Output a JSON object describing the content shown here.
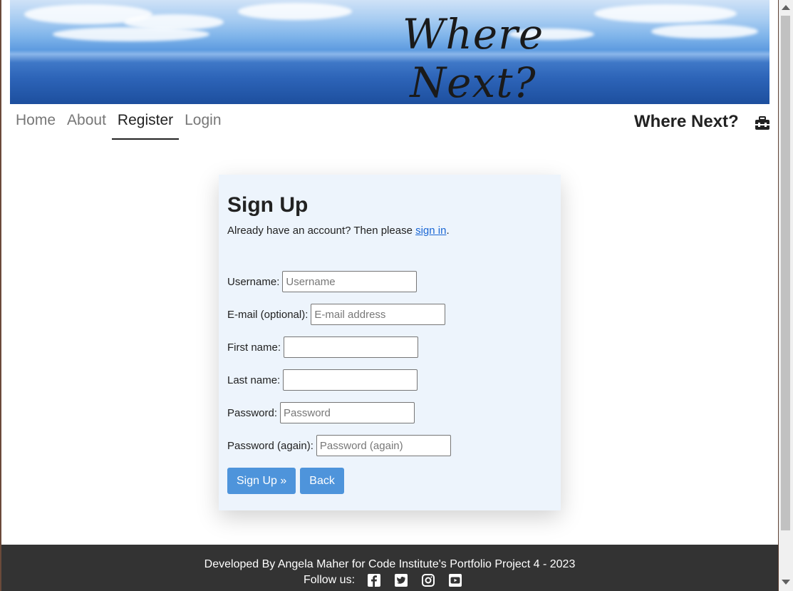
{
  "hero": {
    "title": "Where Next?"
  },
  "nav": {
    "items": [
      {
        "label": "Home",
        "active": false
      },
      {
        "label": "About",
        "active": false
      },
      {
        "label": "Register",
        "active": true
      },
      {
        "label": "Login",
        "active": false
      }
    ],
    "brand": "Where Next?",
    "brand_icon": "toolbox-icon"
  },
  "signup": {
    "title": "Sign Up",
    "intro_text": "Already have an account? Then please ",
    "intro_link": "sign in",
    "intro_end": ".",
    "fields": {
      "username": {
        "label": "Username:",
        "placeholder": "Username",
        "value": ""
      },
      "email": {
        "label": "E-mail (optional):",
        "placeholder": "E-mail address",
        "value": ""
      },
      "first_name": {
        "label": "First name:",
        "placeholder": "",
        "value": ""
      },
      "last_name": {
        "label": "Last name:",
        "placeholder": "",
        "value": ""
      },
      "password": {
        "label": "Password:",
        "placeholder": "Password",
        "value": ""
      },
      "password2": {
        "label": "Password (again):",
        "placeholder": "Password (again)",
        "value": ""
      }
    },
    "submit_label": "Sign Up »",
    "back_label": "Back"
  },
  "footer": {
    "developed_by": "Developed By Angela Maher for Code Institute's Portfolio Project 4 - 2023",
    "follow_label": "Follow us:",
    "social": [
      "facebook-icon",
      "twitter-icon",
      "instagram-icon",
      "youtube-icon"
    ]
  },
  "colors": {
    "button": "#4e94db",
    "card_bg": "#edf4fc",
    "footer_bg": "#333333",
    "link": "#1a66d4"
  }
}
